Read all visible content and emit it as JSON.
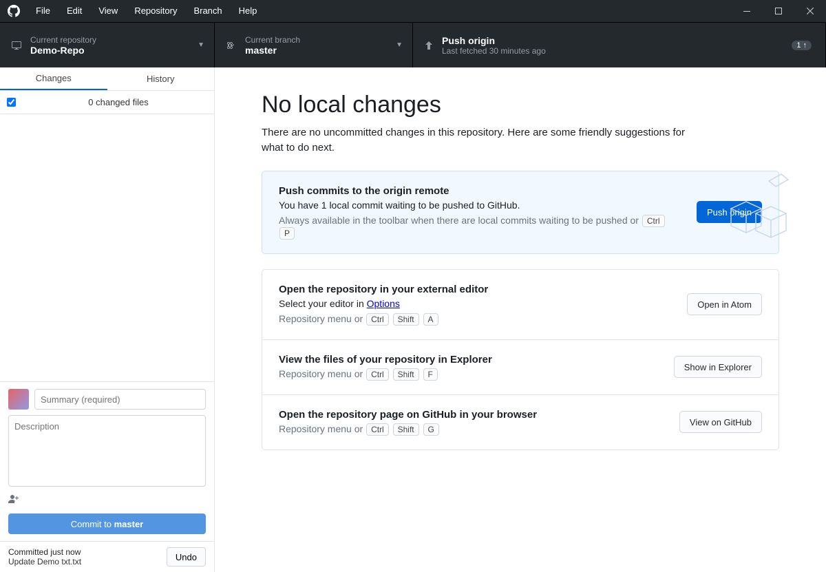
{
  "menu": {
    "file": "File",
    "edit": "Edit",
    "view": "View",
    "repository": "Repository",
    "branch": "Branch",
    "help": "Help"
  },
  "toolbar": {
    "repo_label": "Current repository",
    "repo_name": "Demo-Repo",
    "branch_label": "Current branch",
    "branch_name": "master",
    "push_title": "Push origin",
    "push_sub": "Last fetched 30 minutes ago",
    "push_badge": "1 ↑"
  },
  "sidebar": {
    "tab_changes": "Changes",
    "tab_history": "History",
    "changed_files": "0 changed files",
    "summary_ph": "Summary (required)",
    "description_ph": "Description",
    "commit_prefix": "Commit to ",
    "commit_branch": "master",
    "undo_title": "Committed just now",
    "undo_sub": "Update Demo txt.txt",
    "undo_btn": "Undo"
  },
  "main": {
    "heading": "No local changes",
    "sub": "There are no uncommitted changes in this repository. Here are some friendly suggestions for what to do next.",
    "cards": {
      "push": {
        "title": "Push commits to the origin remote",
        "desc": "You have 1 local commit waiting to be pushed to GitHub.",
        "hint": "Always available in the toolbar when there are local commits waiting to be pushed or",
        "k1": "Ctrl",
        "k2": "P",
        "btn": "Push origin"
      },
      "editor": {
        "title": "Open the repository in your external editor",
        "desc_prefix": "Select your editor in ",
        "desc_link": "Options",
        "hint": "Repository menu or",
        "k1": "Ctrl",
        "k2": "Shift",
        "k3": "A",
        "btn": "Open in Atom"
      },
      "explorer": {
        "title": "View the files of your repository in Explorer",
        "hint": "Repository menu or",
        "k1": "Ctrl",
        "k2": "Shift",
        "k3": "F",
        "btn": "Show in Explorer"
      },
      "github": {
        "title": "Open the repository page on GitHub in your browser",
        "hint": "Repository menu or",
        "k1": "Ctrl",
        "k2": "Shift",
        "k3": "G",
        "btn": "View on GitHub"
      }
    }
  }
}
